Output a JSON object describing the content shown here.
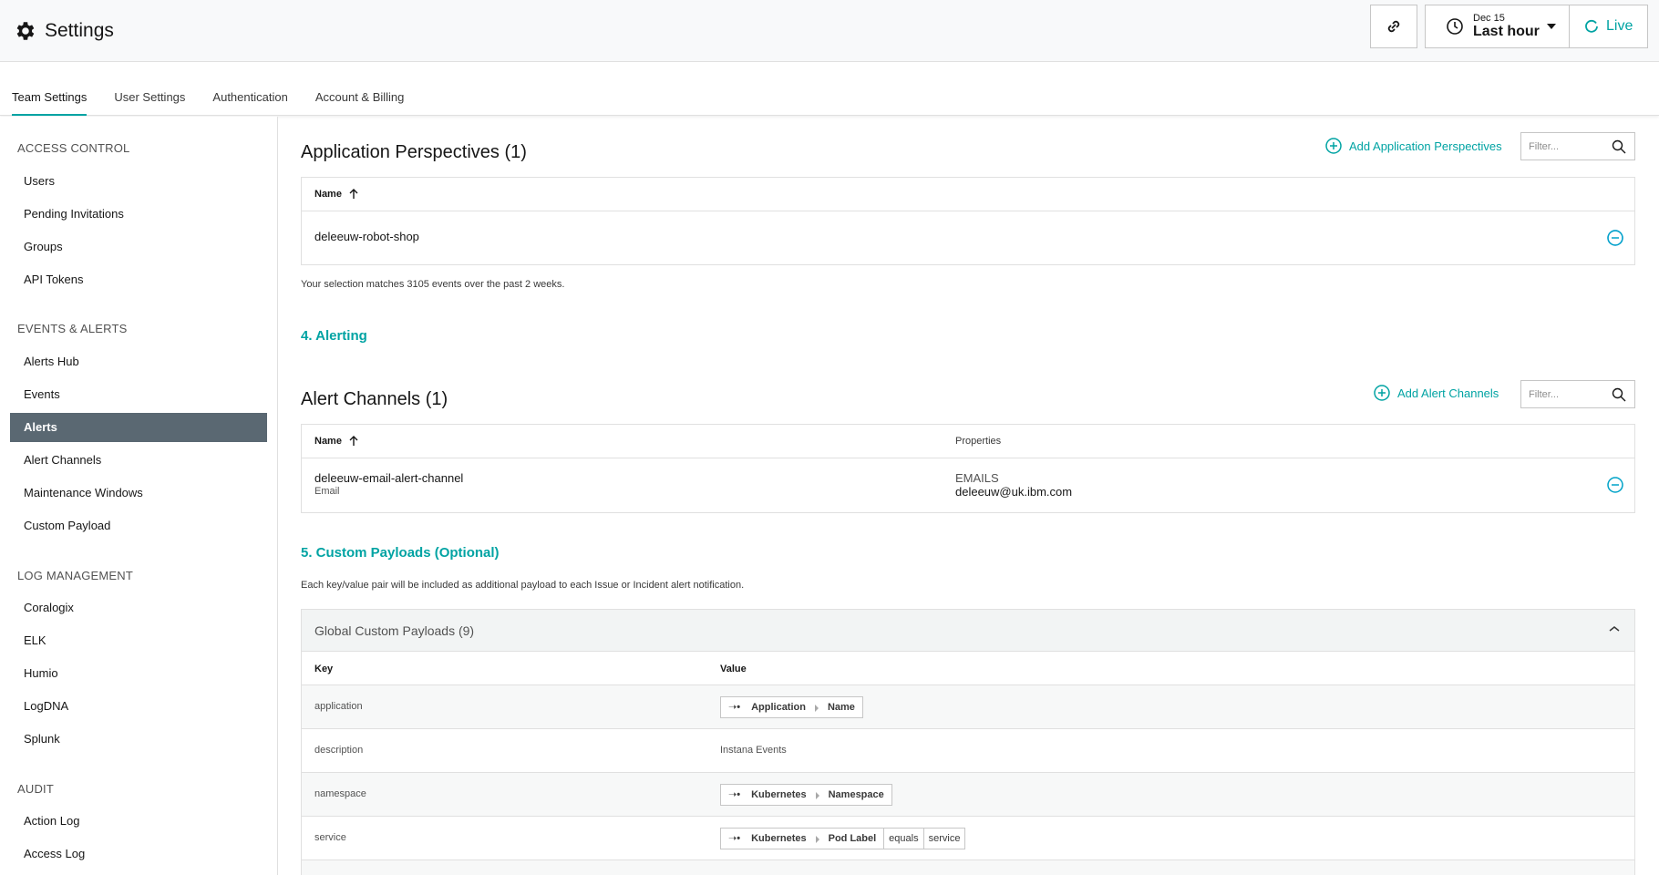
{
  "header": {
    "title": "Settings",
    "time": {
      "date": "Dec 15",
      "range": "Last hour"
    },
    "live_label": "Live",
    "accent": "#00a3a3"
  },
  "tabs": [
    {
      "label": "Team Settings",
      "active": true
    },
    {
      "label": "User Settings"
    },
    {
      "label": "Authentication"
    },
    {
      "label": "Account & Billing"
    }
  ],
  "sidebar": {
    "sections": [
      {
        "title": "ACCESS CONTROL",
        "items": [
          "Users",
          "Pending Invitations",
          "Groups",
          "API Tokens"
        ]
      },
      {
        "title": "EVENTS & ALERTS",
        "items": [
          "Alerts Hub",
          "Events",
          "Alerts",
          "Alert Channels",
          "Maintenance Windows",
          "Custom Payload"
        ]
      },
      {
        "title": "LOG MANAGEMENT",
        "items": [
          "Coralogix",
          "ELK",
          "Humio",
          "LogDNA",
          "Splunk"
        ]
      },
      {
        "title": "AUDIT",
        "items": [
          "Action Log",
          "Access Log"
        ]
      }
    ],
    "active_item": "Alerts"
  },
  "app_perspectives": {
    "title": "Application Perspectives (1)",
    "add_label": "Add Application Perspectives",
    "filter_placeholder": "Filter...",
    "col_name": "Name",
    "rows": [
      {
        "name": "deleeuw-robot-shop"
      }
    ],
    "note": "Your selection matches 3105 events over the past 2 weeks."
  },
  "alerting": {
    "step": "4. Alerting"
  },
  "alert_channels": {
    "title": "Alert Channels (1)",
    "add_label": "Add Alert Channels",
    "filter_placeholder": "Filter...",
    "col_name": "Name",
    "col_props": "Properties",
    "rows": [
      {
        "name": "deleeuw-email-alert-channel",
        "type": "Email",
        "prop_key": "EMAILS",
        "prop_val": "deleeuw@uk.ibm.com"
      }
    ]
  },
  "custom_payloads": {
    "step": "5. Custom Payloads (Optional)",
    "note": "Each key/value pair will be included as additional payload to each Issue or Incident alert notification.",
    "group_title": "Global Custom Payloads (9)",
    "col_key": "Key",
    "col_value": "Value",
    "rows": [
      {
        "key": "application",
        "chip": [
          "Application",
          "Name"
        ]
      },
      {
        "key": "description",
        "text": "Instana Events"
      },
      {
        "key": "namespace",
        "chip": [
          "Kubernetes",
          "Namespace"
        ]
      },
      {
        "key": "service",
        "chip": [
          "Kubernetes",
          "Pod Label"
        ],
        "extra": [
          "equals",
          "service"
        ]
      }
    ]
  }
}
